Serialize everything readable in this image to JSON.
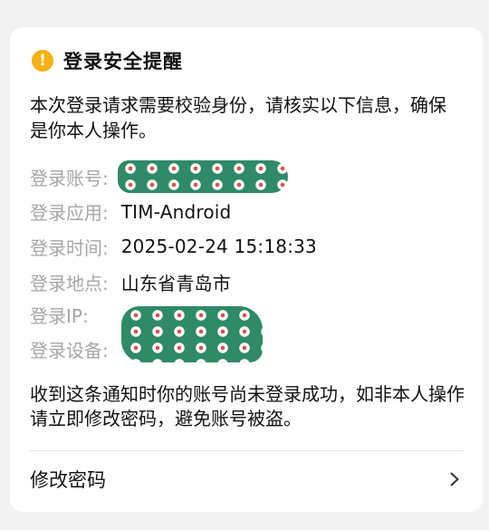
{
  "card": {
    "icon": "warning-icon",
    "icon_glyph": "!",
    "title": "登录安全提醒",
    "intro": "本次登录请求需要校验身份，请核实以下信息，确保是你本人操作。",
    "info": [
      {
        "label": "登录账号:",
        "value": null,
        "redacted": true
      },
      {
        "label": "登录应用:",
        "value": "TIM-Android",
        "redacted": false
      },
      {
        "label": "登录时间:",
        "value": "2025-02-24 15:18:33",
        "redacted": false
      },
      {
        "label": "登录地点:",
        "value": "山东省青岛市",
        "redacted": false
      },
      {
        "label": "登录IP:",
        "value": null,
        "redacted": true
      },
      {
        "label": "登录设备:",
        "value": null,
        "redacted": true
      }
    ],
    "notice": "收到这条通知时你的账号尚未登录成功，如非本人操作请立即修改密码，避免账号被盗。",
    "action": {
      "label": "修改密码",
      "icon": "chevron-right-icon"
    }
  },
  "colors": {
    "accent_warning": "#f4b214",
    "label_gray": "#a6a6a6",
    "text": "#111111",
    "background": "#f2f2f2",
    "redaction_sticker": "#2f8a66"
  }
}
